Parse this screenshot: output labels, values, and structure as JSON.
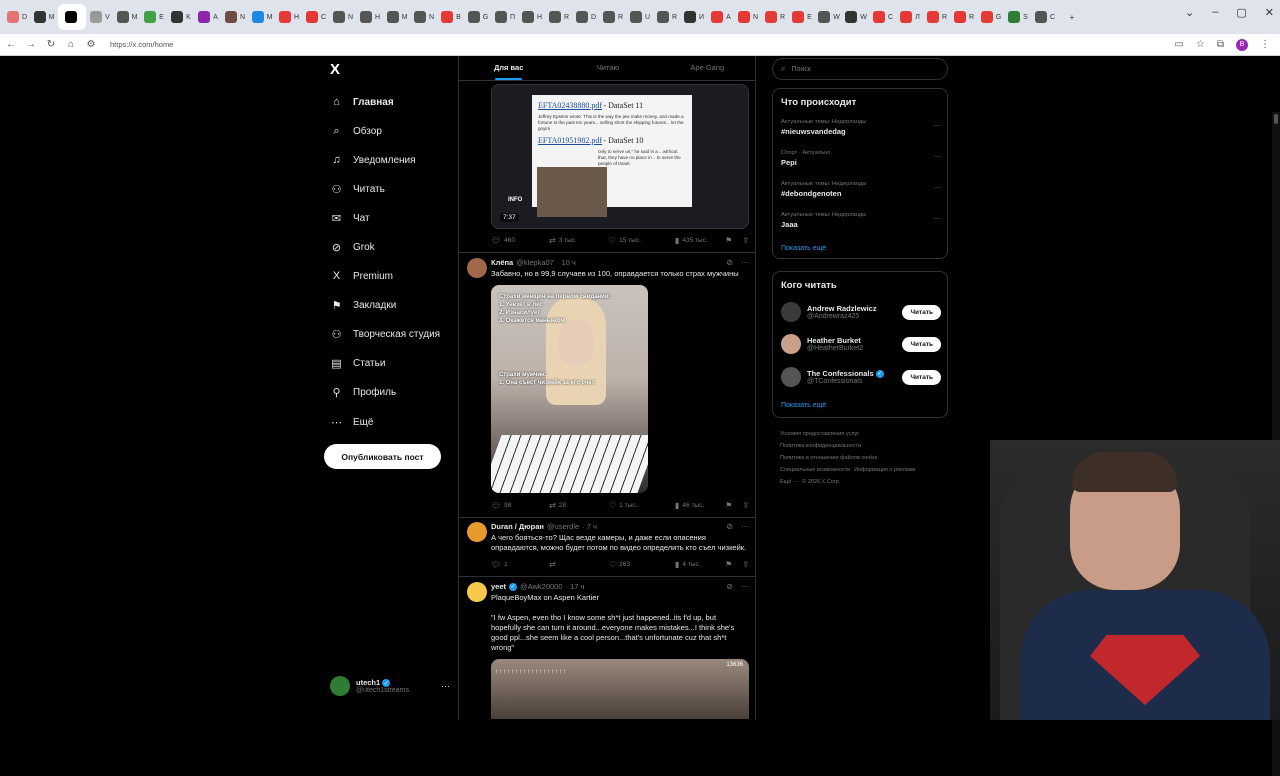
{
  "browser": {
    "tabs": [
      {
        "label": "D",
        "color": "#e57373"
      },
      {
        "label": "M",
        "color": "#333333"
      },
      {
        "label": "",
        "color": "#000000",
        "active": true
      },
      {
        "label": "V",
        "color": "#999999"
      },
      {
        "label": "M",
        "color": "#555555"
      },
      {
        "label": "E",
        "color": "#43a047"
      },
      {
        "label": "K",
        "color": "#333333"
      },
      {
        "label": "A",
        "color": "#8e24aa"
      },
      {
        "label": "N",
        "color": "#6d4c41"
      },
      {
        "label": "M",
        "color": "#1e88e5"
      },
      {
        "label": "H",
        "color": "#e53935"
      },
      {
        "label": "C",
        "color": "#e53935"
      },
      {
        "label": "N",
        "color": "#555555"
      },
      {
        "label": "H",
        "color": "#555555"
      },
      {
        "label": "M",
        "color": "#555555"
      },
      {
        "label": "N",
        "color": "#555555"
      },
      {
        "label": "B",
        "color": "#e53935"
      },
      {
        "label": "G",
        "color": "#555555"
      },
      {
        "label": "П",
        "color": "#555555"
      },
      {
        "label": "H",
        "color": "#555555"
      },
      {
        "label": "R",
        "color": "#555555"
      },
      {
        "label": "D",
        "color": "#555555"
      },
      {
        "label": "R",
        "color": "#555555"
      },
      {
        "label": "U",
        "color": "#555555"
      },
      {
        "label": "R",
        "color": "#555555"
      },
      {
        "label": "И",
        "color": "#333333"
      },
      {
        "label": "A",
        "color": "#e53935"
      },
      {
        "label": "N",
        "color": "#e53935"
      },
      {
        "label": "R",
        "color": "#e53935"
      },
      {
        "label": "E",
        "color": "#e53935"
      },
      {
        "label": "W",
        "color": "#555555"
      },
      {
        "label": "W",
        "color": "#333333"
      },
      {
        "label": "C",
        "color": "#e53935"
      },
      {
        "label": "Л",
        "color": "#e53935"
      },
      {
        "label": "R",
        "color": "#e53935"
      },
      {
        "label": "R",
        "color": "#e53935"
      },
      {
        "label": "G",
        "color": "#e53935"
      },
      {
        "label": "S",
        "color": "#2e7d32"
      },
      {
        "label": "C",
        "color": "#555555"
      }
    ],
    "url": "https://x.com/home"
  },
  "sidebar": {
    "logo": "X",
    "items": [
      {
        "label": "Главная",
        "icon": "⌂",
        "name": "home",
        "bold": true
      },
      {
        "label": "Обзор",
        "icon": "⌕",
        "name": "explore"
      },
      {
        "label": "Уведомления",
        "icon": "♫",
        "name": "notifications"
      },
      {
        "label": "Читать",
        "icon": "⚇",
        "name": "follow"
      },
      {
        "label": "Чат",
        "icon": "✉",
        "name": "chat"
      },
      {
        "label": "Grok",
        "icon": "⊘",
        "name": "grok"
      },
      {
        "label": "Premium",
        "icon": "X",
        "name": "premium"
      },
      {
        "label": "Закладки",
        "icon": "⚑",
        "name": "bookmarks"
      },
      {
        "label": "Творческая студия",
        "icon": "⚇",
        "name": "creator-studio"
      },
      {
        "label": "Статьи",
        "icon": "▤",
        "name": "articles"
      },
      {
        "label": "Профиль",
        "icon": "⚲",
        "name": "profile"
      },
      {
        "label": "Ещё",
        "icon": "⋯",
        "name": "more"
      }
    ],
    "post_button": "Опубликовать пост",
    "account": {
      "name": "utech1",
      "handle": "@utech1streams"
    }
  },
  "feed": {
    "tabs": [
      "Для вас",
      "Читаю",
      "Ape Gang"
    ],
    "video1": {
      "doc_link1": "EFTA02438880.pdf",
      "doc_ds1": "- DataSet 11",
      "doc_text1": "Jeffrey Epstein wrote: This is the way the jew make money, and made a fortune in the past ten years... selling short the shipping futures... let the goyim",
      "doc_link2": "EFTA01951982.pdf",
      "doc_ds2": "- DataSet 10",
      "doc_text2": "only to serve us,\" he said in a ...without that, they have no place in ...to serve the people of Israel.",
      "overlay": "INFO",
      "duration": "7:37",
      "stats": {
        "replies": "460",
        "retweets": "3 тыс.",
        "likes": "15 тыс.",
        "views": "435 тыс."
      }
    },
    "tweet2": {
      "name": "Клёпа",
      "handle": "@klepka07",
      "time": "· 10 ч",
      "text": "Забавно, но в 99,9 случаев из 100, оправдается только страх мужчины",
      "media_top": "Страхи женщин на первом свидании:\n1. Увезёт в лес\n2. Изнасилует\n3. Окажется маньяком",
      "media_bottom": "Страхи мужчин:\n1. Она съест чизкейк за его счет",
      "stats": {
        "replies": "98",
        "retweets": "28",
        "likes": "1 тыс.",
        "views": "46 тыс."
      }
    },
    "tweet3": {
      "name": "Duran / Дюран",
      "handle": "@userdle",
      "time": "· 7 ч",
      "text": "А чего бояться-то? Щас везде камеры, и даже если опасения оправдаются, можно будет потом по видео определить кто съел чизкейк.",
      "stats": {
        "replies": "1",
        "retweets": "",
        "likes": "263",
        "views": "4 тыс."
      }
    },
    "tweet4": {
      "name": "yeet",
      "handle": "@Awk20000",
      "time": "· 17 ч",
      "text1": "PlaqueBoyMax on Aspen Kartier",
      "text2": "\"I fw Aspen, even tho I know some sh*t just happened..its f'd up, but hopefully she can turn it around...everyone makes mistakes...I think she's good ppl...she seem like a cool person...that's unfortunate cuz that sh*t wrong\"",
      "media_count": "13636"
    }
  },
  "right": {
    "search_placeholder": "Поиск",
    "trends_title": "Что происходит",
    "trends": [
      {
        "context": "Актуальные темы: Нидерланды",
        "title": "#nieuwsvandedag"
      },
      {
        "context": "Спорт · Актуально",
        "title": "Pepi"
      },
      {
        "context": "Актуальные темы: Нидерланды",
        "title": "#debondgenoten"
      },
      {
        "context": "Актуальные темы: Нидерланды",
        "title": "Jaaa"
      }
    ],
    "show_more": "Показать ещё",
    "who_title": "Кого читать",
    "who": [
      {
        "name": "Andrew Radzlewicz",
        "handle": "@Andrewraz425",
        "button": "Читать",
        "verified": false
      },
      {
        "name": "Heather Burket",
        "handle": "@HeatherBurket2",
        "button": "Читать",
        "verified": false
      },
      {
        "name": "The Confessionals",
        "handle": "@TConfessionals",
        "button": "Читать",
        "verified": true
      }
    ],
    "footer": [
      "Условия предоставления услуг",
      "Политика конфиденциальности",
      "Политика в отношении файлов cookie",
      "Специальные возможности",
      "Информация о рекламе",
      "Ещё ···",
      "© 2026 X Corp."
    ]
  }
}
